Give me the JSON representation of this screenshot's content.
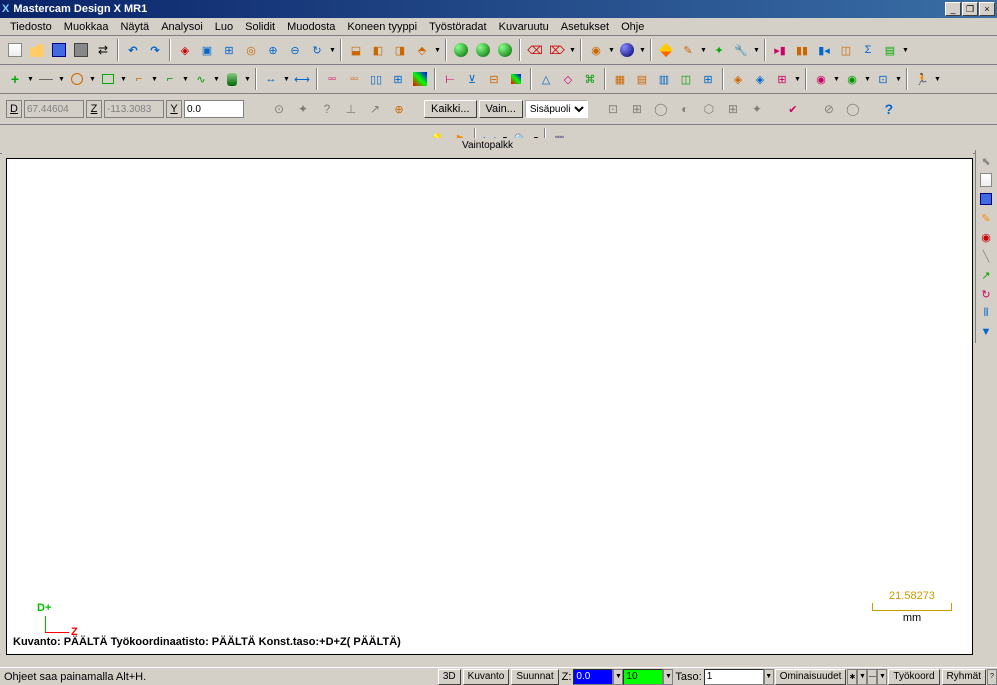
{
  "title": "Mastercam Design X MR1",
  "menu": [
    "Tiedosto",
    "Muokkaa",
    "Näytä",
    "Analysoi",
    "Luo",
    "Solidit",
    "Muodosta",
    "Koneen tyyppi",
    "Työstöradat",
    "Kuvaruutu",
    "Asetukset",
    "Ohje"
  ],
  "coords": {
    "d_label": "D",
    "d_value": "67.44604",
    "z_label": "Z",
    "z_value": "-113.3083",
    "y_label": "Y",
    "y_value": "0.0"
  },
  "buttons": {
    "kaikki": "Kaikki...",
    "vain": "Vain..."
  },
  "combo_selected": "Sisäpuoli",
  "canvas_title": "Vaintopalkk",
  "axis": {
    "d": "D+",
    "z": "Z"
  },
  "scale": {
    "value": "21.58273",
    "unit": "mm"
  },
  "view_status": "Kuvanto: PÄÄLTÄ   Työkoordinaatisto: PÄÄLTÄ   Konst.taso:+D+Z( PÄÄLTÄ)",
  "status": {
    "hint": "Ohjeet saa painamalla Alt+H.",
    "btn_3d": "3D",
    "btn_kuvanto": "Kuvanto",
    "btn_suunnat": "Suunnat",
    "z_label": "Z:",
    "z_val": "0.0",
    "color_val": "10",
    "taso_label": "Taso:",
    "taso_val": "1",
    "btn_ominaisuudet": "Ominaisuudet",
    "btn_tyokoord": "Työkoord",
    "btn_ryhmat": "Ryhmät"
  }
}
